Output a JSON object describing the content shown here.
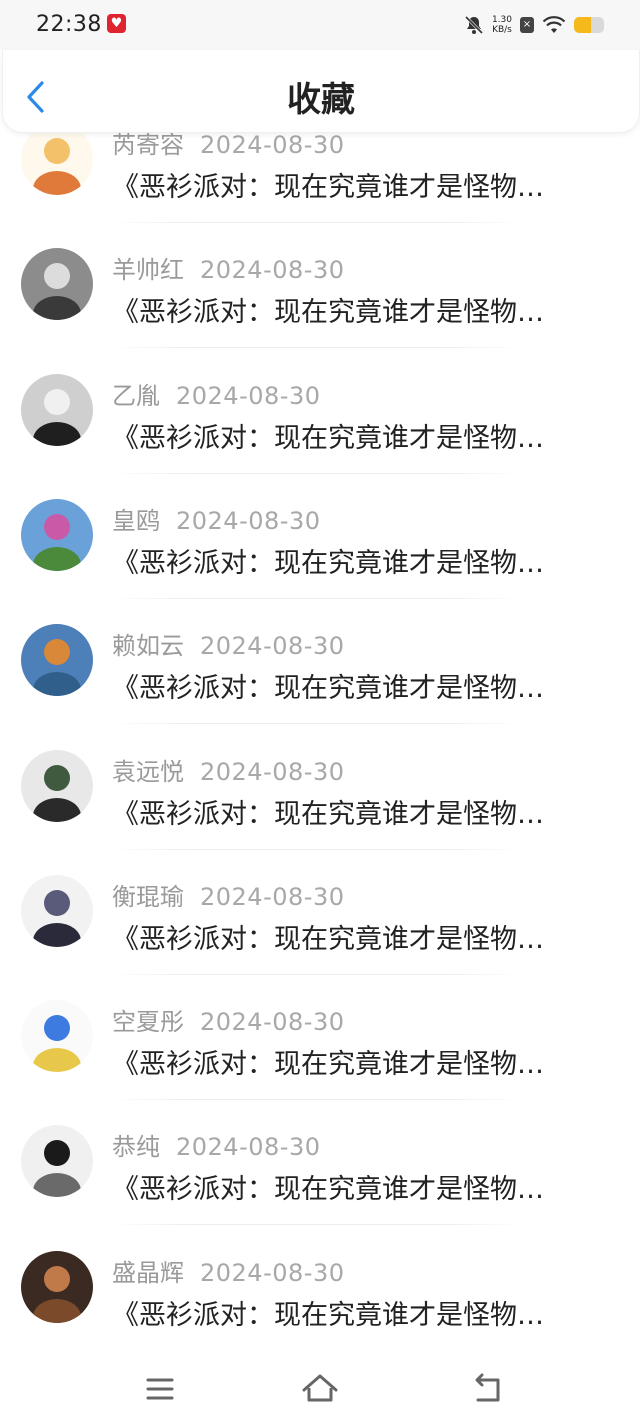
{
  "status_bar": {
    "time": "22:38",
    "app_icon": "app-notification-icon",
    "net_speed_value": "1.30",
    "net_speed_unit": "KB/s",
    "sim_label": "×",
    "battery_level": 0.55,
    "battery_color": "#f6b91c"
  },
  "header": {
    "title": "收藏",
    "back_icon": "chevron-left-icon",
    "accent_color": "#2b8ae8"
  },
  "favorites": [
    {
      "author": "芮寄容",
      "date": "2024-08-30",
      "title": "《恶衫派对：现在究竟谁才是怪物…"
    },
    {
      "author": "羊帅红",
      "date": "2024-08-30",
      "title": "《恶衫派对：现在究竟谁才是怪物…"
    },
    {
      "author": "乙胤",
      "date": "2024-08-30",
      "title": "《恶衫派对：现在究竟谁才是怪物…"
    },
    {
      "author": "皇鸥",
      "date": "2024-08-30",
      "title": "《恶衫派对：现在究竟谁才是怪物…"
    },
    {
      "author": "赖如云",
      "date": "2024-08-30",
      "title": "《恶衫派对：现在究竟谁才是怪物…"
    },
    {
      "author": "袁远悦",
      "date": "2024-08-30",
      "title": "《恶衫派对：现在究竟谁才是怪物…"
    },
    {
      "author": "衡琨瑜",
      "date": "2024-08-30",
      "title": "《恶衫派对：现在究竟谁才是怪物…"
    },
    {
      "author": "空夏彤",
      "date": "2024-08-30",
      "title": "《恶衫派对：现在究竟谁才是怪物…"
    },
    {
      "author": "恭纯",
      "date": "2024-08-30",
      "title": "《恶衫派对：现在究竟谁才是怪物…"
    },
    {
      "author": "盛晶辉",
      "date": "2024-08-30",
      "title": "《恶衫派对：现在究竟谁才是怪物…"
    }
  ],
  "nav_bar": {
    "menu_icon": "menu-icon",
    "home_icon": "home-icon",
    "back_icon": "back-arrow-icon"
  }
}
